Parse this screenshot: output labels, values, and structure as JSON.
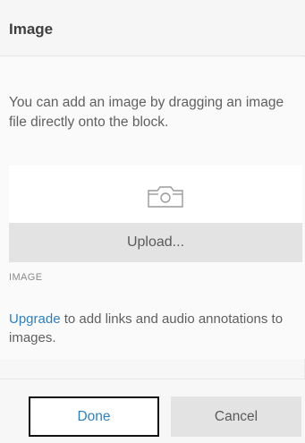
{
  "dialog": {
    "title": "Image"
  },
  "content": {
    "help_text": "You can add an image by dragging an image file directly onto the block.",
    "upload_icon": "camera-icon",
    "upload_button_label": "Upload...",
    "field_label": "IMAGE",
    "upgrade_link": "Upgrade",
    "upgrade_rest": " to add links and audio annotations to images."
  },
  "footer": {
    "done_label": "Done",
    "cancel_label": "Cancel"
  },
  "colors": {
    "link": "#2d7fc4",
    "button_gray": "#e3e3e3",
    "focus_border": "#111111"
  }
}
